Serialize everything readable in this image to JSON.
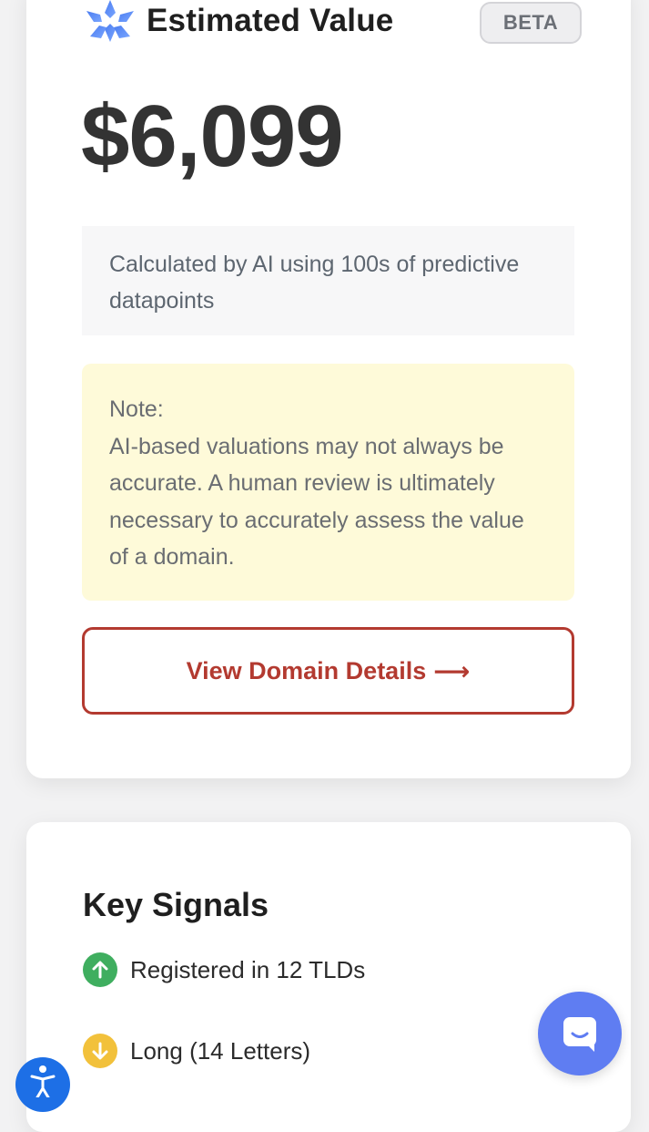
{
  "value_card": {
    "title": "Estimated Value",
    "badge": "BETA",
    "value": "$6,099",
    "calc_text": "Calculated by AI using 100s of predictive datapoints",
    "note_heading": "Note:",
    "note_text": "AI-based valuations may not always be accurate. A human review is ultimately necessary to accurately assess the value of a domain.",
    "cta_label": "View Domain Details",
    "cta_arrow": "⟶",
    "logo_icon": "sparkle-logo-icon"
  },
  "signals_card": {
    "title": "Key Signals",
    "items": [
      {
        "label": "Registered in 12 TLDs",
        "trend": "up",
        "icon": "arrow-up-icon",
        "color": "#3fae5f"
      },
      {
        "label": "Long (14 Letters)",
        "trend": "down",
        "icon": "arrow-down-icon",
        "color": "#f2c13b"
      }
    ]
  },
  "widgets": {
    "chat_icon": "chat-icon",
    "accessibility_icon": "accessibility-icon"
  },
  "colors": {
    "accent": "#b33a30",
    "chat": "#5f7df2",
    "accessibility": "#1d6fe6",
    "note_bg": "#fefad9"
  }
}
